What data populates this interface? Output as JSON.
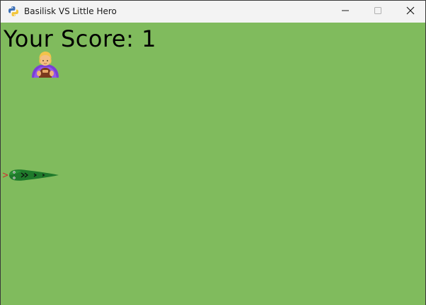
{
  "window": {
    "title": "Basilisk VS Little Hero",
    "app_icon": "python-icon",
    "controls": [
      "minimize-icon",
      "maximize-icon",
      "close-icon"
    ]
  },
  "game": {
    "score_text": "Your Score: 1",
    "background_color": "#80bb5d",
    "player": {
      "name": "little hero",
      "icon": "hero-icon"
    },
    "enemy": {
      "name": "basilisk",
      "icon": "snake-icon",
      "color": "#1f7a2b"
    }
  }
}
